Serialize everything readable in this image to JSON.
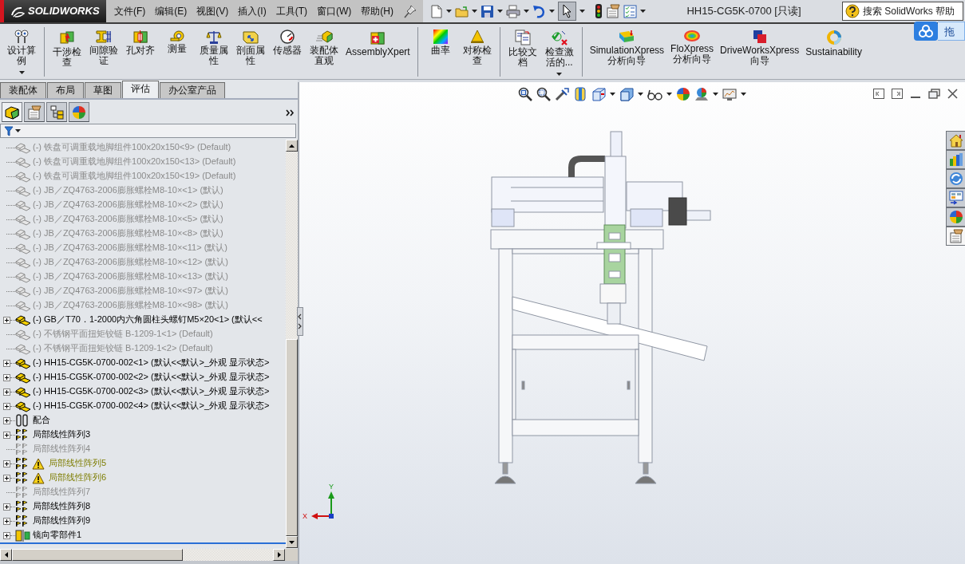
{
  "app_logo": "SOLIDWORKS",
  "menu": [
    "文件(F)",
    "编辑(E)",
    "视图(V)",
    "插入(I)",
    "工具(T)",
    "窗口(W)",
    "帮助(H)"
  ],
  "quick_toolbar": {
    "select_pressed": true
  },
  "document_title": "HH15-CG5K-0700 [只读]",
  "help_search": {
    "placeholder": "搜索 SolidWorks 帮助"
  },
  "floating_widget": {
    "label": "拖"
  },
  "ribbon": [
    {
      "buttons": [
        {
          "label": "设计算例",
          "has_menu": true
        }
      ]
    },
    {
      "buttons": [
        {
          "label": "干涉检查",
          "has_menu": false
        },
        {
          "label": "间隙验证",
          "has_menu": false
        },
        {
          "label": "孔对齐",
          "has_menu": false
        },
        {
          "label": "测量",
          "has_menu": false
        },
        {
          "label": "质量属性",
          "has_menu": false
        },
        {
          "label": "剖面属性",
          "has_menu": false
        },
        {
          "label": "传感器",
          "has_menu": false
        },
        {
          "label": "装配体直观",
          "has_menu": false
        },
        {
          "label": "AssemblyXpert",
          "has_menu": false
        }
      ]
    },
    {
      "buttons": [
        {
          "label": "曲率",
          "has_menu": false
        },
        {
          "label": "对称检查",
          "has_menu": false
        }
      ]
    },
    {
      "buttons": [
        {
          "label": "比较文档",
          "has_menu": false
        },
        {
          "label": "检查激活的...",
          "has_menu": true
        }
      ]
    },
    {
      "buttons": [
        {
          "label": "SimulationXpress 分析向导",
          "has_menu": false
        },
        {
          "label": "FloXpress 分析向导",
          "has_menu": false
        },
        {
          "label": "DriveWorksXpress 向导",
          "has_menu": false
        },
        {
          "label": "Sustainability",
          "has_menu": false
        }
      ]
    }
  ],
  "command_tabs": [
    {
      "label": "装配体",
      "selected": false
    },
    {
      "label": "布局",
      "selected": false
    },
    {
      "label": "草图",
      "selected": false
    },
    {
      "label": "评估",
      "selected": true
    },
    {
      "label": "办公室产品",
      "selected": false
    }
  ],
  "feature_manager": {
    "panel_tabs": [
      {
        "selected": true
      },
      {
        "selected": false
      },
      {
        "selected": false
      },
      {
        "selected": false
      }
    ],
    "tree": [
      {
        "kind": "part",
        "label": "(-) 铁盘可调重载地脚组件100x20x150<9> (Default)",
        "suppressed": true,
        "expandable": false,
        "warning": false
      },
      {
        "kind": "part",
        "label": "(-) 铁盘可调重载地脚组件100x20x150<13> (Default)",
        "suppressed": true,
        "expandable": false,
        "warning": false
      },
      {
        "kind": "part",
        "label": "(-) 铁盘可调重载地脚组件100x20x150<19> (Default)",
        "suppressed": true,
        "expandable": false,
        "warning": false
      },
      {
        "kind": "part",
        "label": "(-) JB／ZQ4763-2006膨胀螺栓M8-10×<1> (默认)",
        "suppressed": true,
        "expandable": false,
        "warning": false
      },
      {
        "kind": "part",
        "label": "(-) JB／ZQ4763-2006膨胀螺栓M8-10×<2> (默认)",
        "suppressed": true,
        "expandable": false,
        "warning": false
      },
      {
        "kind": "part",
        "label": "(-) JB／ZQ4763-2006膨胀螺栓M8-10×<5> (默认)",
        "suppressed": true,
        "expandable": false,
        "warning": false
      },
      {
        "kind": "part",
        "label": "(-) JB／ZQ4763-2006膨胀螺栓M8-10×<8> (默认)",
        "suppressed": true,
        "expandable": false,
        "warning": false
      },
      {
        "kind": "part",
        "label": "(-) JB／ZQ4763-2006膨胀螺栓M8-10×<11> (默认)",
        "suppressed": true,
        "expandable": false,
        "warning": false
      },
      {
        "kind": "part",
        "label": "(-) JB／ZQ4763-2006膨胀螺栓M8-10×<12> (默认)",
        "suppressed": true,
        "expandable": false,
        "warning": false
      },
      {
        "kind": "part",
        "label": "(-) JB／ZQ4763-2006膨胀螺栓M8-10×<13> (默认)",
        "suppressed": true,
        "expandable": false,
        "warning": false
      },
      {
        "kind": "part",
        "label": "(-) JB／ZQ4763-2006膨胀螺栓M8-10×<97> (默认)",
        "suppressed": true,
        "expandable": false,
        "warning": false
      },
      {
        "kind": "part",
        "label": "(-) JB／ZQ4763-2006膨胀螺栓M8-10×<98> (默认)",
        "suppressed": true,
        "expandable": false,
        "warning": false
      },
      {
        "kind": "part",
        "label": "(-) GB／T70．1-2000内六角圆柱头螺钉M5×20<1> (默认<<",
        "suppressed": false,
        "expandable": true,
        "warning": false
      },
      {
        "kind": "part",
        "label": "(-) 不锈钢平面扭矩铰链 B-1209-1<1> (Default)",
        "suppressed": true,
        "expandable": false,
        "warning": false
      },
      {
        "kind": "part",
        "label": "(-) 不锈钢平面扭矩铰链 B-1209-1<2> (Default)",
        "suppressed": true,
        "expandable": false,
        "warning": false
      },
      {
        "kind": "part",
        "label": "(-) HH15-CG5K-0700-002<1> (默认<<默认>_外观 显示状态>",
        "suppressed": false,
        "expandable": true,
        "warning": false
      },
      {
        "kind": "part",
        "label": "(-) HH15-CG5K-0700-002<2> (默认<<默认>_外观 显示状态>",
        "suppressed": false,
        "expandable": true,
        "warning": false
      },
      {
        "kind": "part",
        "label": "(-) HH15-CG5K-0700-002<3> (默认<<默认>_外观 显示状态>",
        "suppressed": false,
        "expandable": true,
        "warning": false
      },
      {
        "kind": "part",
        "label": "(-) HH15-CG5K-0700-002<4> (默认<<默认>_外观 显示状态>",
        "suppressed": false,
        "expandable": true,
        "warning": false
      },
      {
        "kind": "mates",
        "label": "配合",
        "suppressed": false,
        "expandable": true,
        "warning": false
      },
      {
        "kind": "pattern",
        "label": "局部线性阵列3",
        "suppressed": false,
        "expandable": true,
        "warning": false
      },
      {
        "kind": "pattern",
        "label": "局部线性阵列4",
        "suppressed": true,
        "expandable": false,
        "warning": false
      },
      {
        "kind": "pattern",
        "label": "局部线性阵列5",
        "suppressed": false,
        "expandable": true,
        "warning": true
      },
      {
        "kind": "pattern",
        "label": "局部线性阵列6",
        "suppressed": false,
        "expandable": true,
        "warning": true
      },
      {
        "kind": "pattern",
        "label": "局部线性阵列7",
        "suppressed": true,
        "expandable": false,
        "warning": false
      },
      {
        "kind": "pattern",
        "label": "局部线性阵列8",
        "suppressed": false,
        "expandable": true,
        "warning": false
      },
      {
        "kind": "pattern",
        "label": "局部线性阵列9",
        "suppressed": false,
        "expandable": true,
        "warning": false
      },
      {
        "kind": "mirror",
        "label": "镜向零部件1",
        "suppressed": false,
        "expandable": true,
        "warning": false
      }
    ]
  },
  "viewport": {
    "task_pane_tabs": [
      {
        "selected": false
      },
      {
        "selected": false
      },
      {
        "selected": false
      },
      {
        "selected": false
      },
      {
        "selected": false
      },
      {
        "selected": true
      }
    ],
    "triad": {
      "x_label": "X",
      "y_label": "Y"
    }
  }
}
